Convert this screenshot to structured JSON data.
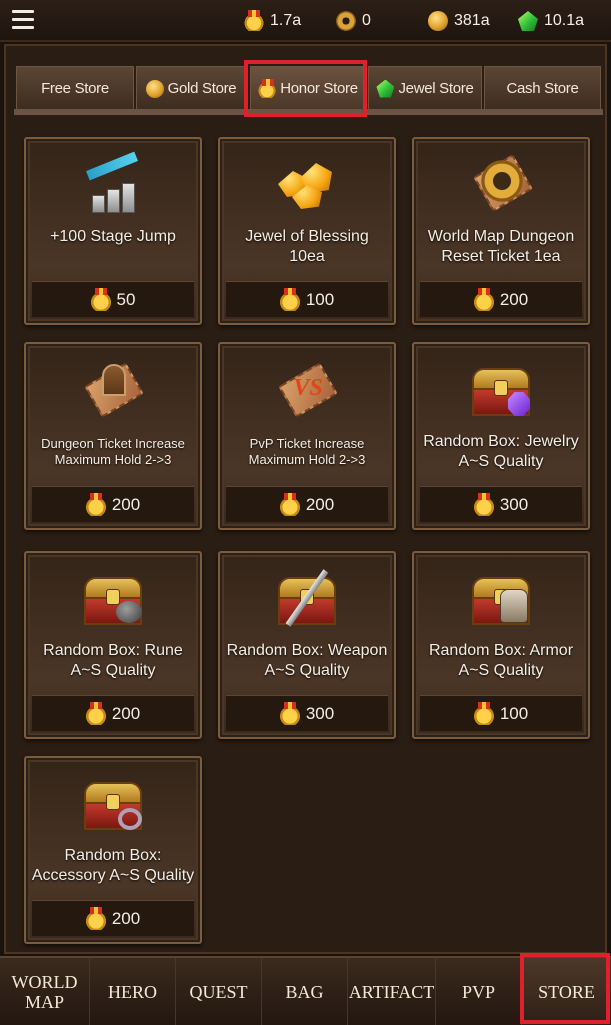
{
  "topbar": {
    "resources": [
      {
        "icon": "honor-medal-icon",
        "value": "1.7a"
      },
      {
        "icon": "gear-token-icon",
        "value": "0"
      },
      {
        "icon": "gold-coin-icon",
        "value": "381a"
      },
      {
        "icon": "green-jewel-icon",
        "value": "10.1a"
      }
    ]
  },
  "tabs": [
    {
      "label": "Free Store",
      "icon": null
    },
    {
      "label": "Gold Store",
      "icon": "gold-coin-icon"
    },
    {
      "label": "Honor Store",
      "icon": "honor-medal-icon",
      "active": true
    },
    {
      "label": "Jewel Store",
      "icon": "green-jewel-icon"
    },
    {
      "label": "Cash Store",
      "icon": null
    }
  ],
  "items": [
    {
      "name": "+100 Stage Jump",
      "price": "50",
      "icon": "stage-jump-icon"
    },
    {
      "name": "Jewel of Blessing 10ea",
      "price": "100",
      "icon": "jewel-of-blessing-icon"
    },
    {
      "name": "World Map Dungeon Reset Ticket 1ea",
      "price": "200",
      "icon": "dungeon-reset-ticket-icon"
    },
    {
      "name": "Dungeon Ticket Increase Maximum Hold 2->3",
      "price": "200",
      "icon": "dungeon-ticket-icon"
    },
    {
      "name": "PvP Ticket Increase Maximum Hold 2->3",
      "price": "200",
      "icon": "pvp-ticket-icon"
    },
    {
      "name": "Random Box: Jewelry A~S Quality",
      "price": "300",
      "icon": "jewelry-box-icon"
    },
    {
      "name": "Random Box: Rune A~S Quality",
      "price": "200",
      "icon": "rune-box-icon"
    },
    {
      "name": "Random Box: Weapon A~S Quality",
      "price": "300",
      "icon": "weapon-box-icon"
    },
    {
      "name": "Random Box: Armor A~S Quality",
      "price": "100",
      "icon": "armor-box-icon"
    },
    {
      "name": "Random Box: Accessory A~S Quality",
      "price": "200",
      "icon": "accessory-box-icon"
    }
  ],
  "nav": [
    {
      "label": "WORLD MAP"
    },
    {
      "label": "HERO"
    },
    {
      "label": "QUEST"
    },
    {
      "label": "BAG"
    },
    {
      "label": "ARTIFACT"
    },
    {
      "label": "PVP"
    },
    {
      "label": "STORE",
      "active": true
    }
  ],
  "colors": {
    "highlight": "#e0202a",
    "panel": "#2a1d14",
    "card": "#4a3626"
  }
}
